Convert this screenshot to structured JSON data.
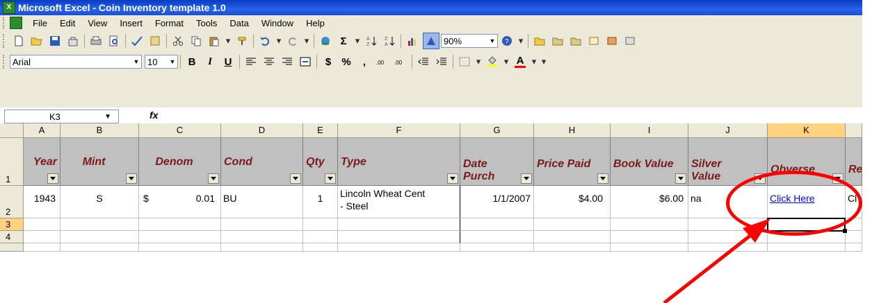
{
  "window": {
    "title": "Microsoft Excel - Coin Inventory template 1.0",
    "app_icon": "excel-icon"
  },
  "menu": [
    "File",
    "Edit",
    "View",
    "Insert",
    "Format",
    "Tools",
    "Data",
    "Window",
    "Help"
  ],
  "toolbar": {
    "zoom": "90%"
  },
  "format_toolbar": {
    "font": "Arial",
    "size": "10",
    "bold": "B",
    "italic": "I",
    "underline": "U",
    "dollar": "$",
    "percent": "%",
    "comma": ",",
    "font_color_letter": "A"
  },
  "formula_bar": {
    "name_box": "K3",
    "fx": "fx"
  },
  "columns": [
    "A",
    "B",
    "C",
    "D",
    "E",
    "F",
    "G",
    "H",
    "I",
    "J",
    "K"
  ],
  "rows": [
    "1",
    "2",
    "3",
    "4"
  ],
  "headers": [
    "Year",
    "Mint",
    "Denom",
    "Cond",
    "Qty",
    "Type",
    "Date Purch",
    "Price Paid",
    "Book Value",
    "Silver Value",
    "Obverse",
    "Re"
  ],
  "row2": {
    "year": "1943",
    "mint": "S",
    "denom_symbol": "$",
    "denom_value": "0.01",
    "cond": "BU",
    "qty": "1",
    "type_line1": "Lincoln Wheat Cent",
    "type_line2": "- Steel",
    "date": "1/1/2007",
    "price": "$4.00",
    "book": "$6.00",
    "silver": "na",
    "obverse": "Click Here",
    "reverse_partial": "Cl"
  },
  "colors": {
    "annotation": "#ff0000",
    "header_text": "#7b1a1a",
    "link": "#0000ff"
  }
}
